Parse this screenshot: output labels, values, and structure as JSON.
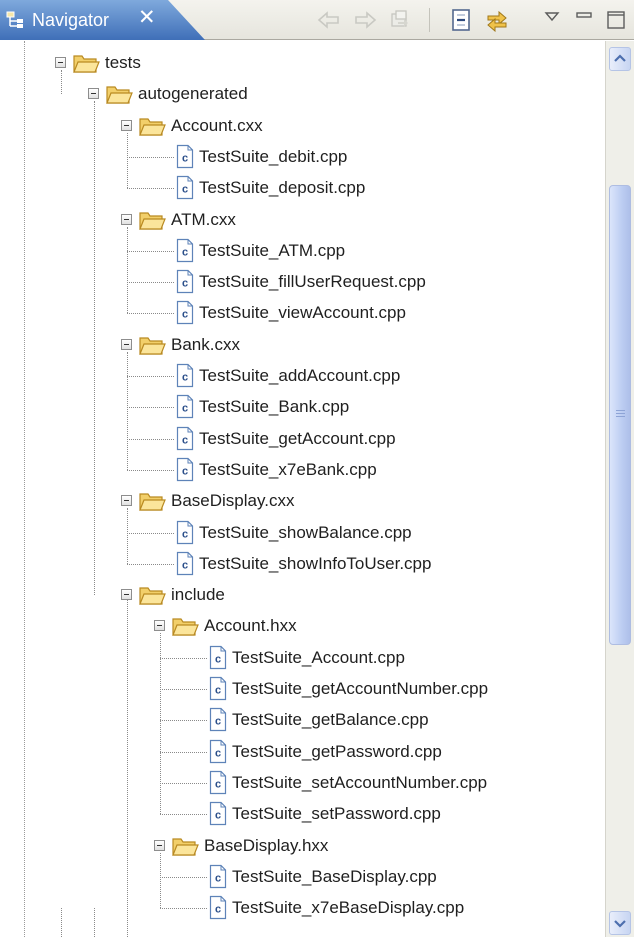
{
  "view": {
    "title": "Navigator",
    "close_label": "✕"
  },
  "toolbar": {
    "buttons": [
      {
        "name": "back-icon"
      },
      {
        "name": "forward-icon"
      },
      {
        "name": "go-into-icon"
      },
      {
        "name": "collapse-all-icon"
      },
      {
        "name": "link-with-editor-icon"
      },
      {
        "name": "view-menu-icon"
      },
      {
        "name": "minimize-icon"
      },
      {
        "name": "maximize-icon"
      }
    ]
  },
  "tree": [
    {
      "label": "tests",
      "type": "folder",
      "depth": 0
    },
    {
      "label": "autogenerated",
      "type": "folder",
      "depth": 1
    },
    {
      "label": "Account.cxx",
      "type": "folder",
      "depth": 2
    },
    {
      "label": "TestSuite_debit.cpp",
      "type": "file",
      "depth": 3
    },
    {
      "label": "TestSuite_deposit.cpp",
      "type": "file",
      "depth": 3
    },
    {
      "label": "ATM.cxx",
      "type": "folder",
      "depth": 2
    },
    {
      "label": "TestSuite_ATM.cpp",
      "type": "file",
      "depth": 3
    },
    {
      "label": "TestSuite_fillUserRequest.cpp",
      "type": "file",
      "depth": 3
    },
    {
      "label": "TestSuite_viewAccount.cpp",
      "type": "file",
      "depth": 3
    },
    {
      "label": "Bank.cxx",
      "type": "folder",
      "depth": 2
    },
    {
      "label": "TestSuite_addAccount.cpp",
      "type": "file",
      "depth": 3
    },
    {
      "label": "TestSuite_Bank.cpp",
      "type": "file",
      "depth": 3
    },
    {
      "label": "TestSuite_getAccount.cpp",
      "type": "file",
      "depth": 3
    },
    {
      "label": "TestSuite_x7eBank.cpp",
      "type": "file",
      "depth": 3
    },
    {
      "label": "BaseDisplay.cxx",
      "type": "folder",
      "depth": 2
    },
    {
      "label": "TestSuite_showBalance.cpp",
      "type": "file",
      "depth": 3
    },
    {
      "label": "TestSuite_showInfoToUser.cpp",
      "type": "file",
      "depth": 3
    },
    {
      "label": "include",
      "type": "folder",
      "depth": 2
    },
    {
      "label": "Account.hxx",
      "type": "folder",
      "depth": 3
    },
    {
      "label": "TestSuite_Account.cpp",
      "type": "file",
      "depth": 4
    },
    {
      "label": "TestSuite_getAccountNumber.cpp",
      "type": "file",
      "depth": 4
    },
    {
      "label": "TestSuite_getBalance.cpp",
      "type": "file",
      "depth": 4
    },
    {
      "label": "TestSuite_getPassword.cpp",
      "type": "file",
      "depth": 4
    },
    {
      "label": "TestSuite_setAccountNumber.cpp",
      "type": "file",
      "depth": 4
    },
    {
      "label": "TestSuite_setPassword.cpp",
      "type": "file",
      "depth": 4
    },
    {
      "label": "BaseDisplay.hxx",
      "type": "folder",
      "depth": 3
    },
    {
      "label": "TestSuite_BaseDisplay.cpp",
      "type": "file",
      "depth": 4
    },
    {
      "label": "TestSuite_x7eBaseDisplay.cpp",
      "type": "file",
      "depth": 4
    }
  ],
  "colors": {
    "tab_active": "#3f6fb8",
    "folder_fill": "#f2cf6a",
    "folder_stroke": "#b98a22",
    "file_icon_stroke": "#5e83b8",
    "scroll_thumb": "#bccdf2"
  }
}
